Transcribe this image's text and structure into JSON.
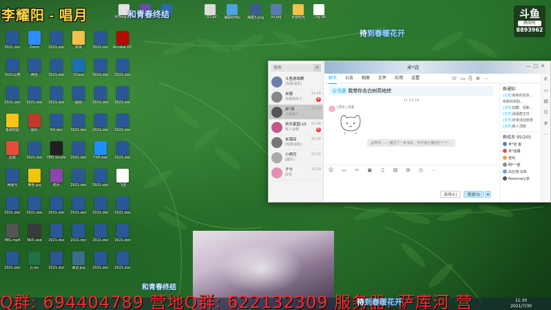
{
  "overlay": {
    "stream_title": "李耀阳 - 唱月",
    "song_top": "和青春终结",
    "song_right_prefix": "待",
    "song_right_hl": "到春暖花开",
    "song_bottom_left": "和青春终结",
    "song_bottom_right_prefix": "待",
    "song_bottom_right_hl": "到春暖花开",
    "ticker": "Q群: 694404789  营地Q群: 622132309  服务器: 萨库河  营",
    "logo": {
      "brand": "斗鱼",
      "room_label": "房间号",
      "room_number": "8893962"
    }
  },
  "desktop": {
    "top_icons": [
      {
        "label": "HiTong.exe",
        "color": "#e3e3e3",
        "icon": "app-icon"
      },
      {
        "label": "",
        "color": "#6a4ea8",
        "icon": "app-icon"
      },
      {
        "label": "",
        "color": "#2a6ab0",
        "icon": "app-icon"
      },
      {
        "label": "…01.gif",
        "color": "#dcdcdc",
        "icon": "image-icon"
      },
      {
        "label": "海联KPNG",
        "color": "#4aa3e0",
        "icon": "image-icon"
      },
      {
        "label": "海报3.png",
        "color": "#3b5c8f",
        "icon": "image-icon"
      },
      {
        "label": "xz.jpg",
        "color": "#5a7bb0",
        "icon": "image-icon"
      },
      {
        "label": "平安时光",
        "color": "#f2c14e",
        "icon": "folder-icon"
      },
      {
        "label": "…ng.ldt",
        "color": "#ffffff",
        "icon": "file-icon"
      }
    ],
    "icons": [
      {
        "label": "2021.doc",
        "color": "#2b5797"
      },
      {
        "label": "2021以用",
        "color": "#2b5797"
      },
      {
        "label": "2021.doc",
        "color": "#2b5797"
      },
      {
        "label": "金融权配",
        "color": "#f5c518"
      },
      {
        "label": "迅雷",
        "color": "#e74c3c"
      },
      {
        "label": "网易号",
        "color": "#2b5797"
      },
      {
        "label": "2021.doc",
        "color": "#2b5797"
      },
      {
        "label": "IMG.mp4",
        "color": "#555555"
      },
      {
        "label": "2021.doc",
        "color": "#2b5797"
      },
      {
        "label": "Zoom",
        "color": "#2d8cff"
      },
      {
        "label": "微信",
        "color": "#2b5797"
      },
      {
        "label": "2021.doc",
        "color": "#2b5797"
      },
      {
        "label": "图片",
        "color": "#c0392b"
      },
      {
        "label": "2021.doc",
        "color": "#2b5797"
      },
      {
        "label": "黄色.jpg",
        "color": "#f1c40f"
      },
      {
        "label": "2021.doc",
        "color": "#2b5797"
      },
      {
        "label": "NUC.exe",
        "color": "#3a3a3a"
      },
      {
        "label": "Jt.xls",
        "color": "#1e7145"
      },
      {
        "label": "2021.doc",
        "color": "#2b5797"
      },
      {
        "label": "2021.doc",
        "color": "#2b5797"
      },
      {
        "label": "2021.doc",
        "color": "#2b5797"
      },
      {
        "label": "NX.doc",
        "color": "#2b5797"
      },
      {
        "label": "OBS Studio",
        "color": "#202020"
      },
      {
        "label": "影片",
        "color": "#8e44ad"
      },
      {
        "label": "2021.doc",
        "color": "#2b5797"
      },
      {
        "label": "2021.doc",
        "color": "#2b5797"
      },
      {
        "label": "2021.doc",
        "color": "#2b5797"
      },
      {
        "label": "目录",
        "color": "#f2c14e"
      },
      {
        "label": "1T.exe",
        "color": "#1a6fb5"
      },
      {
        "label": "联网",
        "color": "#2b5797"
      },
      {
        "label": "2021.doc",
        "color": "#2b5797"
      },
      {
        "label": "2021.doc",
        "color": "#2b5797"
      },
      {
        "label": "2021.doc",
        "color": "#2b5797"
      },
      {
        "label": "2021.doc",
        "color": "#2b5797"
      },
      {
        "label": "2021.doc",
        "color": "#2b5797"
      },
      {
        "label": "湖泊.jpg",
        "color": "#3a6e8f"
      },
      {
        "label": "2021.doc",
        "color": "#2b5797"
      },
      {
        "label": "2021.doc",
        "color": "#2b5797"
      },
      {
        "label": "2021.doc",
        "color": "#2b5797"
      },
      {
        "label": "2021.doc",
        "color": "#2b5797"
      },
      {
        "label": "FXE.exe",
        "color": "#1e90ff"
      },
      {
        "label": "2021.doc",
        "color": "#2b5797"
      },
      {
        "label": "2021.doc",
        "color": "#2b5797"
      },
      {
        "label": "2021.doc",
        "color": "#2b5797"
      },
      {
        "label": "2021.doc",
        "color": "#2b5797"
      },
      {
        "label": "Acrobat DC",
        "color": "#b30b00"
      },
      {
        "label": "2021.doc",
        "color": "#2b5797"
      },
      {
        "label": "2021.doc",
        "color": "#2b5797"
      },
      {
        "label": "2021.doc",
        "color": "#2b5797"
      },
      {
        "label": "2021.doc",
        "color": "#2b5797"
      },
      {
        "label": "飞连",
        "color": "#ffffff"
      },
      {
        "label": "2021.doc",
        "color": "#2b5797"
      },
      {
        "label": "2021.doc",
        "color": "#2b5797"
      },
      {
        "label": "2021.doc",
        "color": "#2b5797"
      },
      {
        "label": "2021.doc",
        "color": "#2b5797"
      }
    ]
  },
  "chat": {
    "search_placeholder": "搜索",
    "plus": "+",
    "conversations": [
      {
        "name": "斗鱼游戏群",
        "preview": "[有新消息]",
        "time": "",
        "badge": "",
        "color": "#6b7fa8"
      },
      {
        "name": "米德",
        "preview": "米德退出了…",
        "time": "11:40",
        "badge": "4",
        "color": "#888888"
      },
      {
        "name": "米*店",
        "preview": "斗鱼@了…",
        "time": "11:23",
        "badge": "",
        "color": "#555555"
      },
      {
        "name": "欢乐家园-15",
        "preview": "有人@我",
        "time": "10:38",
        "badge": "6",
        "color": "#c05a8a"
      },
      {
        "name": "米源店",
        "preview": "[有新消息]",
        "time": "10:26",
        "badge": "",
        "color": "#777777"
      },
      {
        "name": "小明月",
        "preview": "[图片]",
        "time": "10:21",
        "badge": "",
        "color": "#aaaaaa"
      },
      {
        "name": "子兮",
        "preview": "红包",
        "time": "10:19",
        "badge": "",
        "color": "#e08fb0"
      }
    ],
    "group_name": "米*店",
    "tabs": [
      "聊天",
      "公告",
      "相册",
      "文件",
      "应用",
      "设置"
    ],
    "pinned_at": "@浅夏",
    "pinned_text": "我带你去白树高地挖",
    "timestamp": "11:23:19",
    "sender": "[潜水] 浅夏",
    "system_note": "@明月 ——撤回了一条消息，你可通过撤回打了个…",
    "buttons": {
      "close": "关闭(C)",
      "send": "发送(S)",
      "arrow": "▾"
    },
    "right_panel": {
      "notice_title": "群通知",
      "notices": [
        {
          "tag": "[公告]",
          "text": "有新的任务…"
        },
        {
          "tag": "",
          "text": "有新的奖励…"
        },
        {
          "tag": "[文件]",
          "text": "加群、招新…"
        },
        {
          "tag": "[文件]",
          "text": "请看群文件"
        },
        {
          "tag": "[文件]",
          "text": "日常活动安排"
        },
        {
          "tag": "[文件]",
          "text": "新人须知"
        }
      ],
      "members_title": "群成员 95/205",
      "members": [
        {
          "name": "米*店 鱼",
          "color": "#5a7bb0"
        },
        {
          "name": "米*店路",
          "color": "#d9534f"
        },
        {
          "name": "老鸡",
          "color": "#e8a04a"
        },
        {
          "name": "明*一部",
          "color": "#888888"
        },
        {
          "name": "白左地-马布",
          "color": "#6a9fd6"
        },
        {
          "name": "Rosemary.泉",
          "color": "#555555"
        }
      ]
    }
  },
  "clock": {
    "time": "11:30",
    "date": "2021/7/30"
  },
  "colors": {
    "accent": "#12b7f5",
    "ticker": "#ff2a2a",
    "title": "#ffd84a"
  }
}
